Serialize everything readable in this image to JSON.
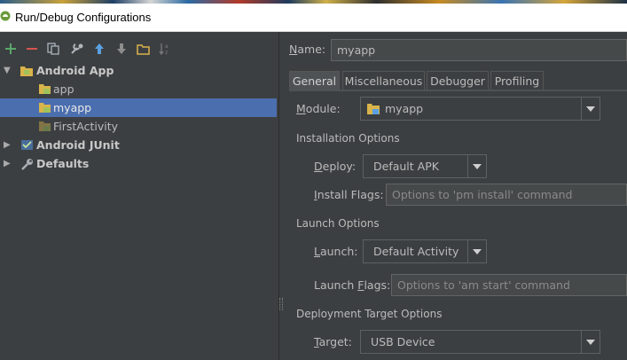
{
  "window": {
    "title": "Run/Debug Configurations"
  },
  "toolbar": {
    "buttons": [
      "add-icon",
      "remove-icon",
      "copy-icon",
      "edit-defaults-icon",
      "move-up-icon",
      "move-down-icon",
      "folder-icon",
      "sort-icon"
    ]
  },
  "tree": {
    "android_app": "Android App",
    "children": [
      "app",
      "myapp",
      "FirstActivity"
    ],
    "android_junit": "Android JUnit",
    "defaults": "Defaults"
  },
  "name": {
    "label_pre": "",
    "label_u": "N",
    "label_post": "ame:",
    "value": "myapp"
  },
  "tabs": [
    "General",
    "Miscellaneous",
    "Debugger",
    "Profiling"
  ],
  "module": {
    "label_u": "M",
    "label_post": "odule:",
    "value": "myapp"
  },
  "installation": {
    "title": "Installation Options",
    "deploy_label_u": "D",
    "deploy_label_post": "eploy:",
    "deploy_value": "Default APK",
    "flags_label_u": "I",
    "flags_label_post": "nstall Flags:",
    "flags_placeholder": "Options to 'pm install' command"
  },
  "launch": {
    "title": "Launch Options",
    "launch_label_u": "L",
    "launch_label_post": "aunch:",
    "launch_value": "Default Activity",
    "flags_label_pre": "Launch ",
    "flags_label_u": "F",
    "flags_label_post": "lags:",
    "flags_placeholder": "Options to 'am start' command"
  },
  "deployment": {
    "title": "Deployment Target Options",
    "target_label_u": "T",
    "target_label_post": "arget:",
    "target_value": "USB Device"
  },
  "colors": {
    "selection": "#4b6eaf",
    "background": "#3c3f41",
    "add": "#59a869",
    "remove": "#d9534f"
  }
}
